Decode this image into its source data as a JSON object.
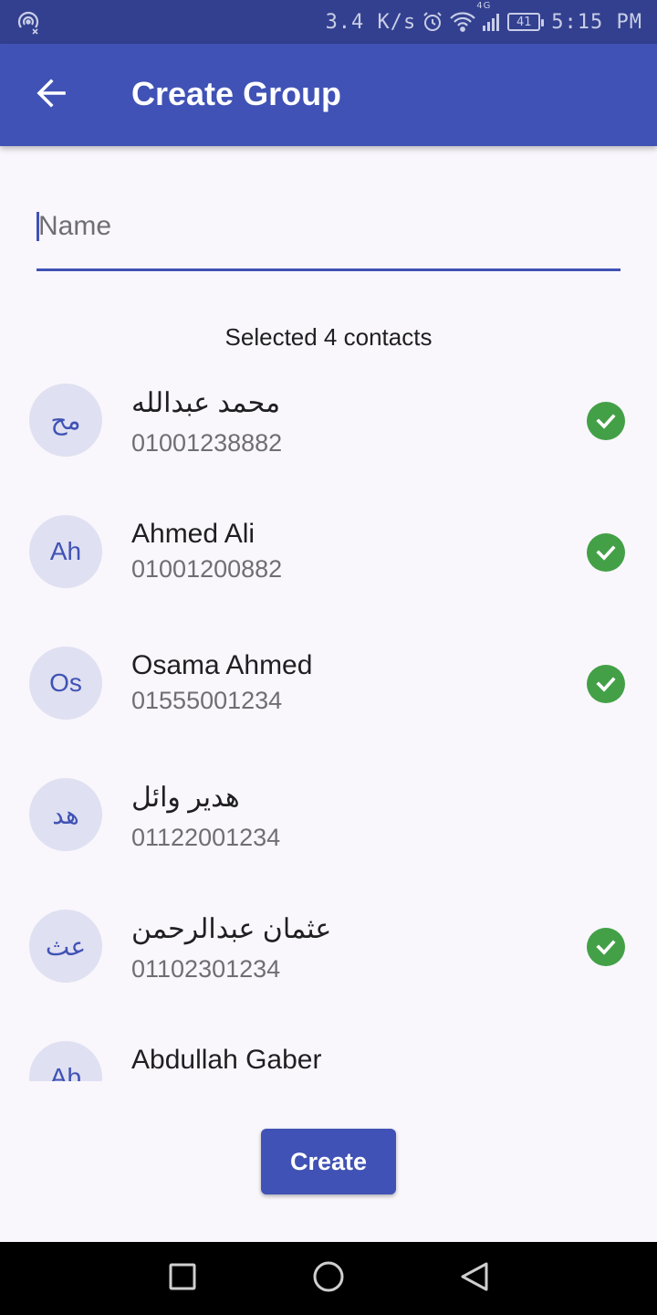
{
  "status_bar": {
    "speed": "3.4 K/s",
    "network": "4G",
    "battery": "41",
    "time": "5:15 PM"
  },
  "app_bar": {
    "title": "Create Group"
  },
  "name_field": {
    "value": "",
    "placeholder": "Name"
  },
  "selected_text": "Selected 4 contacts",
  "contacts": [
    {
      "initials": "مح",
      "name": "محمد عبدالله",
      "phone": "01001238882",
      "selected": true
    },
    {
      "initials": "Ah",
      "name": "Ahmed Ali",
      "phone": "01001200882",
      "selected": true
    },
    {
      "initials": "Os",
      "name": "Osama Ahmed",
      "phone": "01555001234",
      "selected": true
    },
    {
      "initials": "هد",
      "name": "هدير وائل",
      "phone": "01122001234",
      "selected": false
    },
    {
      "initials": "عث",
      "name": "عثمان عبدالرحمن",
      "phone": "01102301234",
      "selected": true
    },
    {
      "initials": "Ab",
      "name": "Abdullah Gaber",
      "phone": "",
      "selected": false
    }
  ],
  "create_button": "Create",
  "colors": {
    "primary": "#4052b5",
    "status_bar": "#32408f",
    "check": "#43a047",
    "avatar_bg": "#dfe0f1"
  }
}
